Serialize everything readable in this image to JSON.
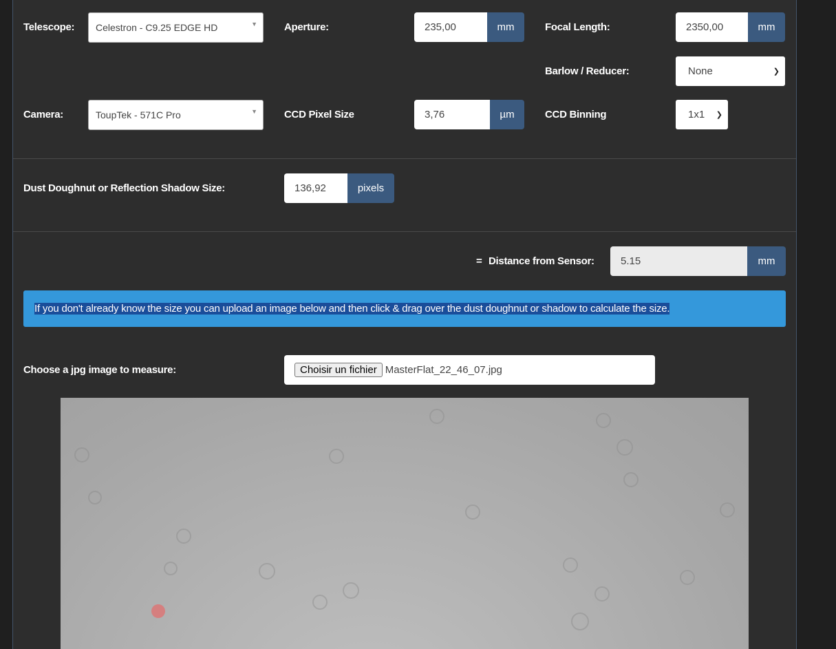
{
  "telescope": {
    "label": "Telescope:",
    "selected": "Celestron - C9.25 EDGE HD"
  },
  "aperture": {
    "label": "Aperture:",
    "value": "235,00",
    "unit": "mm"
  },
  "focal_length": {
    "label": "Focal Length:",
    "value": "2350,00",
    "unit": "mm"
  },
  "barlow": {
    "label": "Barlow / Reducer:",
    "selected": "None"
  },
  "camera": {
    "label": "Camera:",
    "selected": "ToupTek - 571C Pro"
  },
  "pixel_size": {
    "label": "CCD Pixel Size",
    "value": "3,76",
    "unit": "µm"
  },
  "binning": {
    "label": "CCD Binning",
    "selected": "1x1"
  },
  "shadow": {
    "label": "Dust Doughnut or Reflection Shadow Size:",
    "value": "136,92",
    "unit": "pixels"
  },
  "distance": {
    "equals": "=",
    "label": "Distance from Sensor:",
    "value": "5.15",
    "unit": "mm"
  },
  "info_text": "If you don't already know the size you can upload an image below and then click & drag over the dust doughnut or shadow to calculate the size.",
  "file": {
    "label": "Choose a jpg image to measure:",
    "button": "Choisir un fichier",
    "filename": "MasterFlat_22_46_07.jpg"
  },
  "colors": {
    "accent": "#3b5a7f",
    "info_bg": "#3498db",
    "panel_bg": "#2d2d2d",
    "marker": "#d97a7a"
  }
}
